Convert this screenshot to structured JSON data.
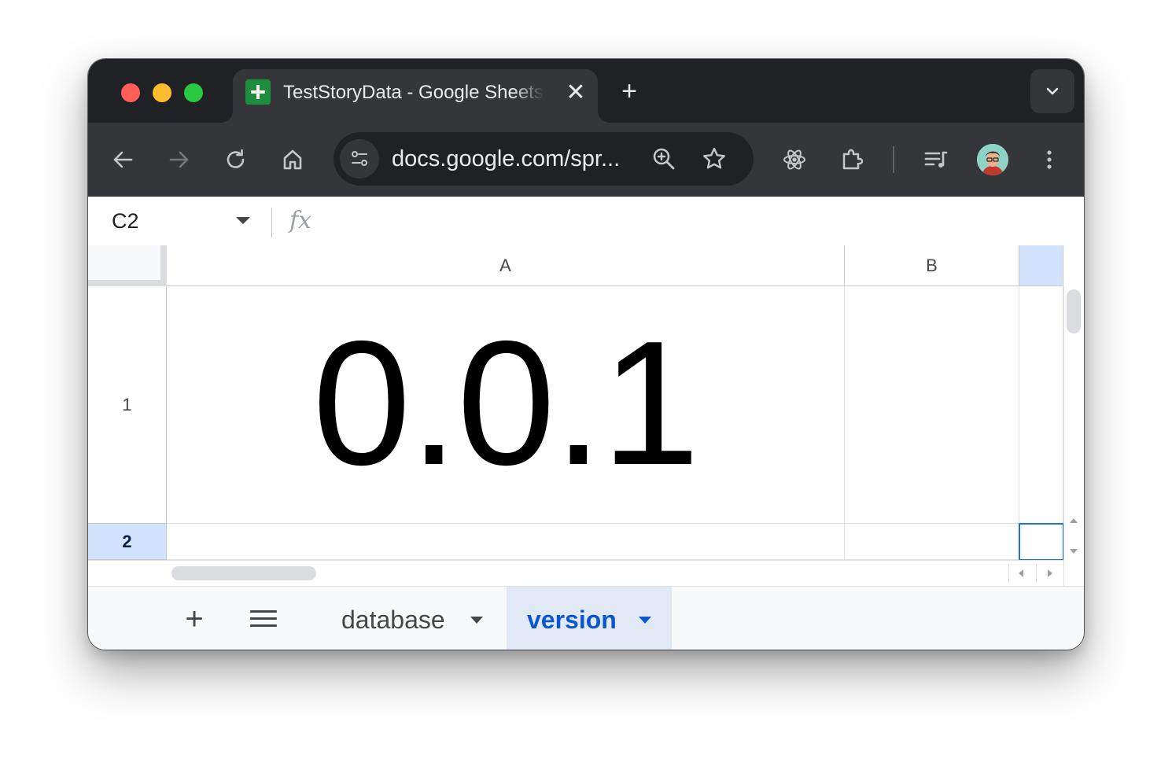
{
  "browser": {
    "tab_title": "TestStoryData - Google Sheets",
    "new_tab_symbol": "+",
    "close_symbol": "✕",
    "url": "docs.google.com/spr..."
  },
  "spreadsheet": {
    "name_box": "C2",
    "formula_value": "",
    "columns": [
      "A",
      "B"
    ],
    "rows": [
      "1",
      "2"
    ],
    "cells": {
      "A1": "0.0.1"
    },
    "selected_cell": "C2"
  },
  "sheets": {
    "tabs": [
      {
        "label": "database",
        "active": false
      },
      {
        "label": "version",
        "active": true
      }
    ]
  },
  "colors": {
    "accent": "#0b57d0",
    "selection": "#1a73e8",
    "header_selected": "#d3e3fd"
  }
}
